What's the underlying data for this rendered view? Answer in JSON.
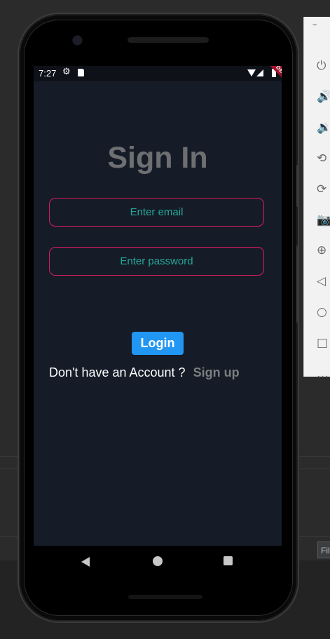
{
  "status_bar": {
    "time": "7:27",
    "debug_banner": "DEBUG"
  },
  "sign_in": {
    "title": "Sign In",
    "email_placeholder": "Enter email",
    "password_placeholder": "Enter password",
    "login_label": "Login",
    "no_account_text": "Don't have an Account ?",
    "signup_label": "Sign up"
  },
  "ide": {
    "filter_tab_label": "Filt"
  },
  "colors": {
    "screen_background": "#161c27",
    "field_border": "#d81b60",
    "placeholder_text": "#26a69a",
    "login_button": "#2196f3",
    "title_text": "#6e6f72",
    "debug_banner": "#a0132b"
  },
  "icons": {
    "status": [
      "gear-icon",
      "sd-card-icon",
      "wifi-icon",
      "signal-icon",
      "battery-icon"
    ],
    "nav": [
      "back-icon",
      "home-icon",
      "recents-icon"
    ],
    "emulator_toolbar": [
      "power-icon",
      "volume-up-icon",
      "volume-down-icon",
      "rotate-left-icon",
      "rotate-right-icon",
      "camera-icon",
      "zoom-icon",
      "back-icon",
      "home-icon",
      "overview-icon",
      "more-icon"
    ]
  }
}
